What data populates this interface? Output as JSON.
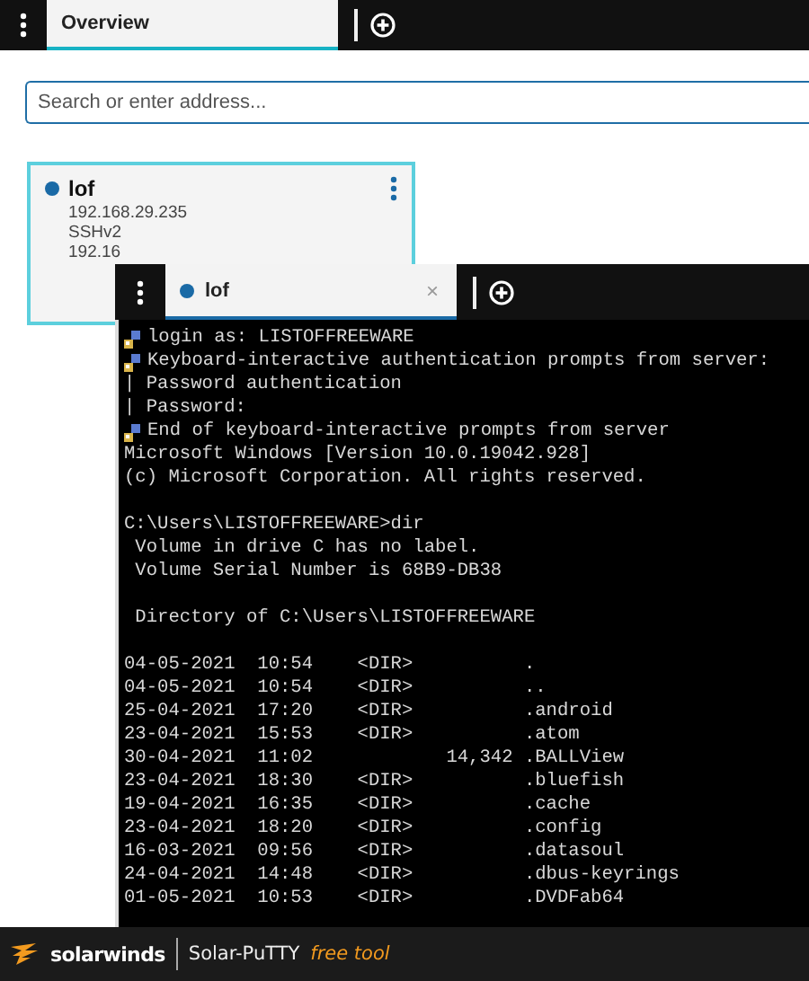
{
  "tabs": [
    {
      "label": "Overview",
      "selected": true
    }
  ],
  "search": {
    "placeholder": "Search or enter address..."
  },
  "sessions": [
    {
      "name": "lof",
      "color": "#1a6aa6",
      "details": [
        "192.168.29.235",
        "SSHv2",
        "192.16"
      ]
    }
  ],
  "terminal_window": {
    "tabs": [
      {
        "label": "lof",
        "selected": true,
        "color": "#1a6aa6",
        "close": "×"
      }
    ],
    "lines": [
      {
        "kind": "key",
        "text": "login as: LISTOFFREEWARE"
      },
      {
        "kind": "key",
        "text": "Keyboard-interactive authentication prompts from server:"
      },
      {
        "kind": "text",
        "text": "| Password authentication"
      },
      {
        "kind": "text",
        "text": "| Password:"
      },
      {
        "kind": "key",
        "text": "End of keyboard-interactive prompts from server"
      },
      {
        "kind": "text",
        "text": "Microsoft Windows [Version 10.0.19042.928]"
      },
      {
        "kind": "text",
        "text": "(c) Microsoft Corporation. All rights reserved."
      },
      {
        "kind": "blank"
      },
      {
        "kind": "text",
        "text": "C:\\Users\\LISTOFFREEWARE>dir"
      },
      {
        "kind": "text",
        "text": " Volume in drive C has no label."
      },
      {
        "kind": "text",
        "text": " Volume Serial Number is 68B9-DB38"
      },
      {
        "kind": "blank"
      },
      {
        "kind": "text",
        "text": " Directory of C:\\Users\\LISTOFFREEWARE"
      },
      {
        "kind": "blank"
      },
      {
        "kind": "text",
        "text": "04-05-2021  10:54    <DIR>          ."
      },
      {
        "kind": "text",
        "text": "04-05-2021  10:54    <DIR>          .."
      },
      {
        "kind": "text",
        "text": "25-04-2021  17:20    <DIR>          .android"
      },
      {
        "kind": "text",
        "text": "23-04-2021  15:53    <DIR>          .atom"
      },
      {
        "kind": "text",
        "text": "30-04-2021  11:02            14,342 .BALLView"
      },
      {
        "kind": "text",
        "text": "23-04-2021  18:30    <DIR>          .bluefish"
      },
      {
        "kind": "text",
        "text": "19-04-2021  16:35    <DIR>          .cache"
      },
      {
        "kind": "text",
        "text": "23-04-2021  18:20    <DIR>          .config"
      },
      {
        "kind": "text",
        "text": "16-03-2021  09:56    <DIR>          .datasoul"
      },
      {
        "kind": "text",
        "text": "24-04-2021  14:48    <DIR>          .dbus-keyrings"
      },
      {
        "kind": "text",
        "text": "01-05-2021  10:53    <DIR>          .DVDFab64"
      }
    ]
  },
  "footer": {
    "brand": "solarwinds",
    "product": "Solar-PuTTY",
    "tagline": "free tool"
  }
}
